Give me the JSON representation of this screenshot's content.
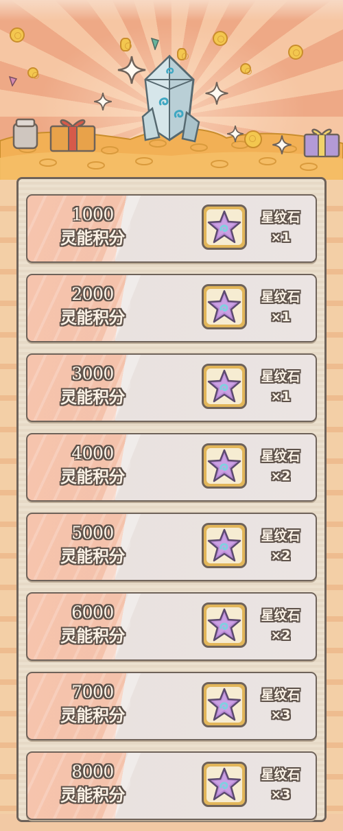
{
  "banner": {
    "crystal_icon": "energy-crystal",
    "decor_icons": [
      "gold-coin",
      "gift-box",
      "sparkle-star",
      "coin-pile"
    ]
  },
  "reward_item_icon": "star-pattern-stone",
  "tiers": [
    {
      "score": "1000",
      "score_label": "灵能积分",
      "reward_name": "星纹石",
      "reward_qty": "×1"
    },
    {
      "score": "2000",
      "score_label": "灵能积分",
      "reward_name": "星纹石",
      "reward_qty": "×1"
    },
    {
      "score": "3000",
      "score_label": "灵能积分",
      "reward_name": "星纹石",
      "reward_qty": "×1"
    },
    {
      "score": "4000",
      "score_label": "灵能积分",
      "reward_name": "星纹石",
      "reward_qty": "×2"
    },
    {
      "score": "5000",
      "score_label": "灵能积分",
      "reward_name": "星纹石",
      "reward_qty": "×2"
    },
    {
      "score": "6000",
      "score_label": "灵能积分",
      "reward_name": "星纹石",
      "reward_qty": "×2"
    },
    {
      "score": "7000",
      "score_label": "灵能积分",
      "reward_name": "星纹石",
      "reward_qty": "×3"
    },
    {
      "score": "8000",
      "score_label": "灵能积分",
      "reward_name": "星纹石",
      "reward_qty": "×3"
    }
  ],
  "colors": {
    "banner_ray_light": "#f6c6a3",
    "banner_ray_dark": "#eea986",
    "panel_bg": "#e9dcc9",
    "row_left": "#f4c2ab",
    "row_right": "#ebe4e3",
    "outline": "#6e6259",
    "star_purple": "#b98ad6",
    "swirl_cyan": "#7fd0e0"
  }
}
